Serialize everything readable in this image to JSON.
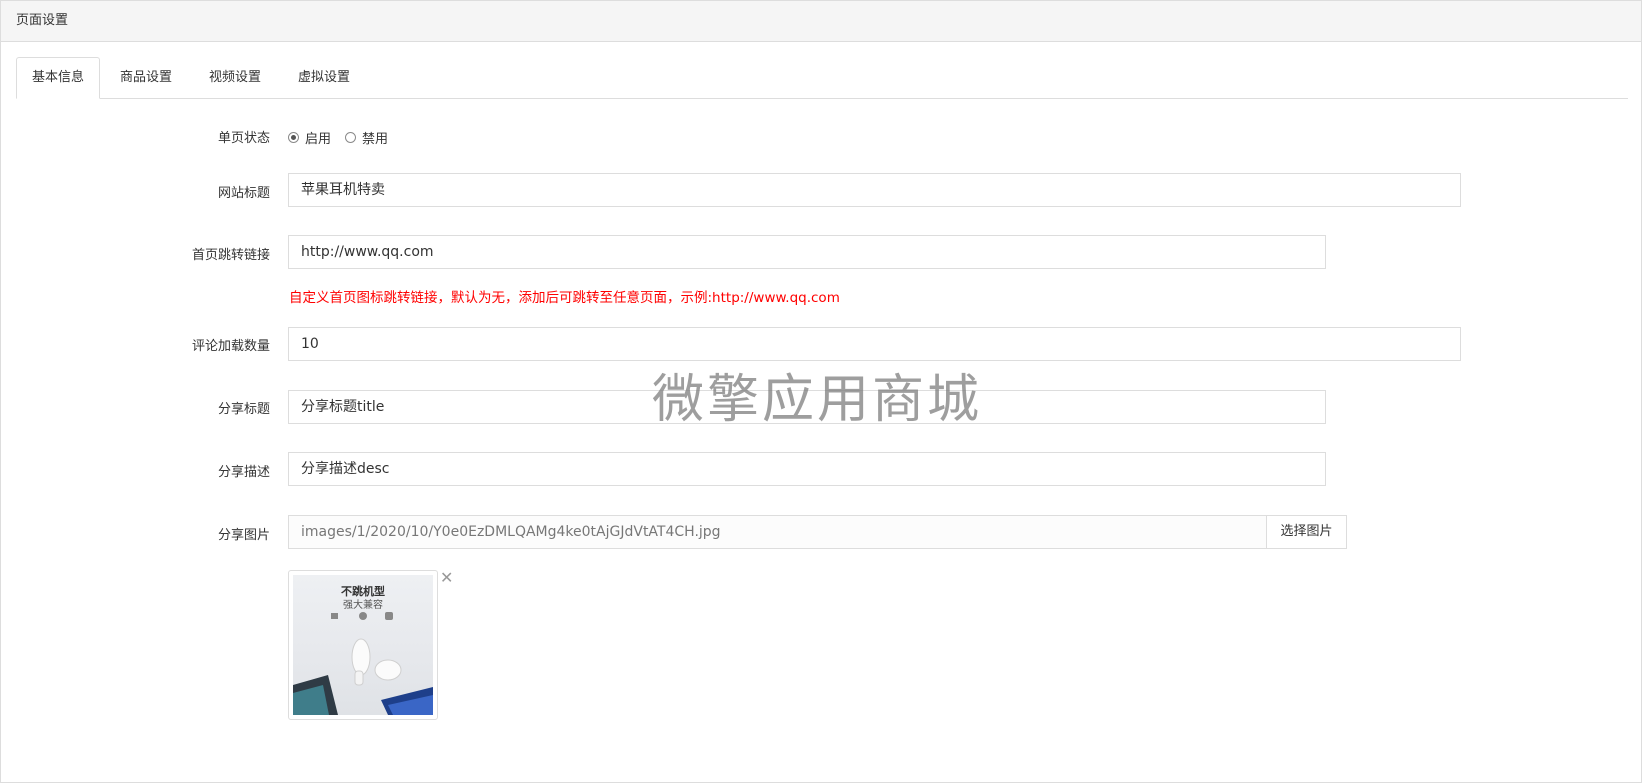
{
  "header": {
    "title": "页面设置"
  },
  "tabs": [
    {
      "label": "基本信息",
      "active": true
    },
    {
      "label": "商品设置",
      "active": false
    },
    {
      "label": "视频设置",
      "active": false
    },
    {
      "label": "虚拟设置",
      "active": false
    }
  ],
  "form": {
    "status": {
      "label": "单页状态",
      "options": [
        {
          "label": "启用",
          "checked": true
        },
        {
          "label": "禁用",
          "checked": false
        }
      ]
    },
    "site_title": {
      "label": "网站标题",
      "value": "苹果耳机特卖"
    },
    "home_link": {
      "label": "首页跳转链接",
      "value": "http://www.qq.com",
      "help": "自定义首页图标跳转链接，默认为无，添加后可跳转至任意页面，示例:http://www.qq.com"
    },
    "comment_count": {
      "label": "评论加载数量",
      "value": "10"
    },
    "share_title": {
      "label": "分享标题",
      "value": "分享标题title"
    },
    "share_desc": {
      "label": "分享描述",
      "value": "分享描述desc"
    },
    "share_image": {
      "label": "分享图片",
      "value": "images/1/2020/10/Y0e0EzDMLQAMg4ke0tAjGJdVtAT4CH.jpg",
      "button": "选择图片",
      "preview_title": "不跳机型",
      "preview_subtitle": "强大兼容",
      "remove_icon": "close-icon"
    }
  },
  "watermark": "微擎应用商城",
  "colors": {
    "help_text": "#ff0000",
    "border": "#dddddd",
    "heading_bg": "#f5f5f5"
  }
}
